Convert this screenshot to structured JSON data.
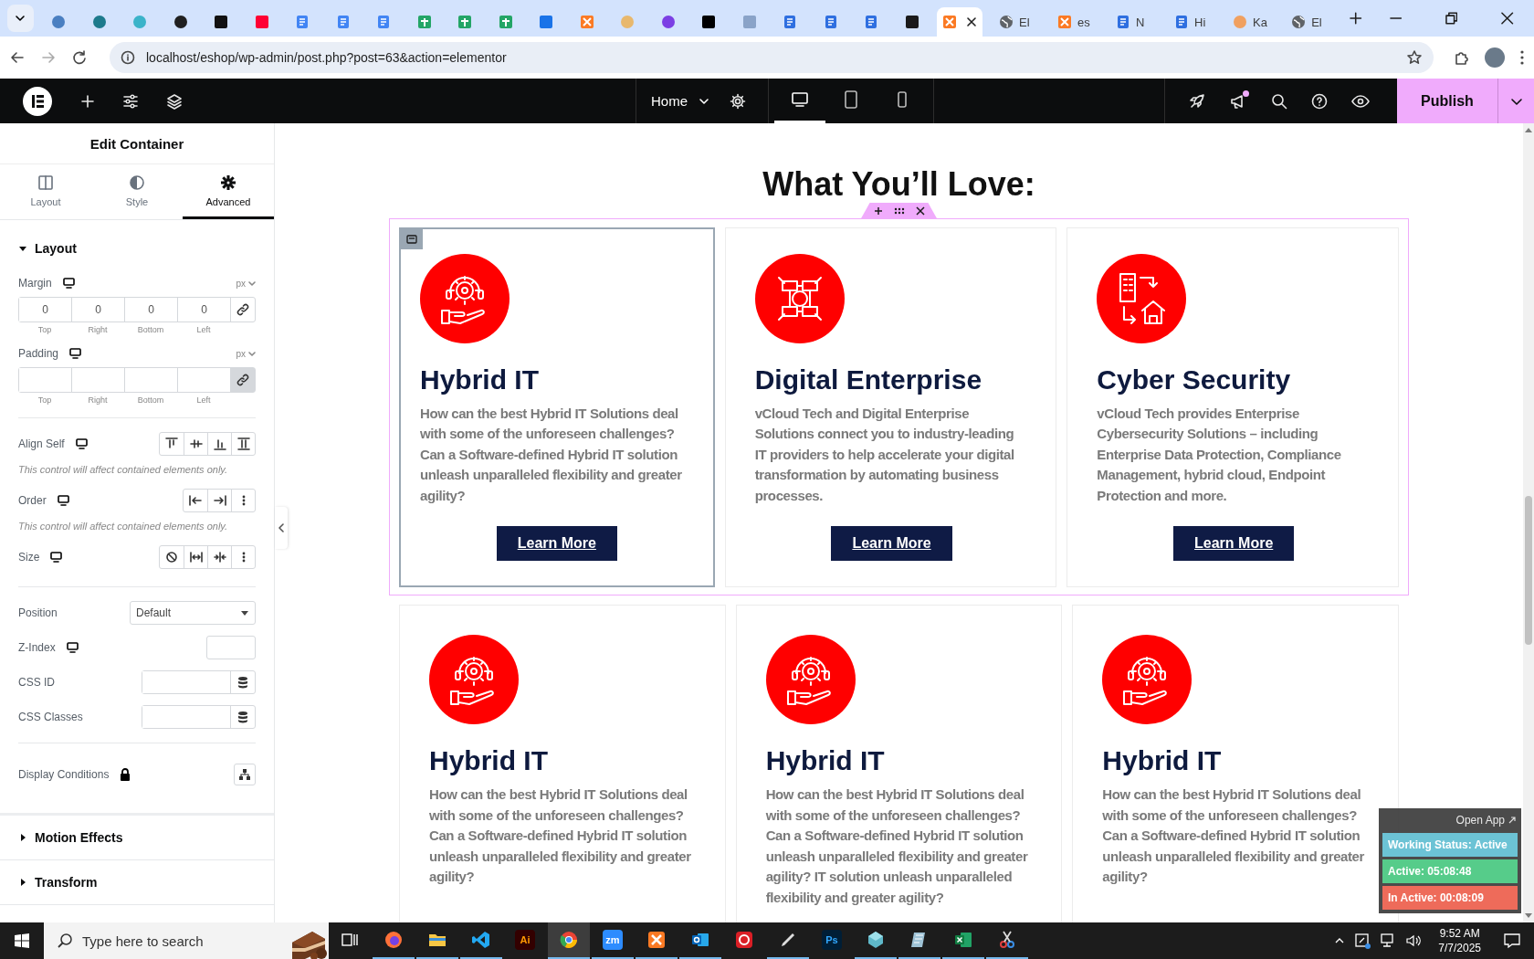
{
  "browser": {
    "tabs": [
      {
        "kind": "circle",
        "color": "#4a7fc1",
        "selected": false
      },
      {
        "kind": "circle",
        "color": "#1d7a8c",
        "selected": false
      },
      {
        "kind": "circle",
        "color": "#3bb3c9",
        "selected": false
      },
      {
        "kind": "circle",
        "color": "#202020",
        "selected": false
      },
      {
        "kind": "square",
        "color": "#111111",
        "selected": false
      },
      {
        "kind": "square",
        "color": "#ff0033",
        "selected": false
      },
      {
        "kind": "doc",
        "color": "#4285f4",
        "selected": false
      },
      {
        "kind": "doc",
        "color": "#4285f4",
        "selected": false
      },
      {
        "kind": "doc",
        "color": "#4285f4",
        "selected": false
      },
      {
        "kind": "sheet",
        "color": "#23a566",
        "selected": false
      },
      {
        "kind": "sheet",
        "color": "#23a566",
        "selected": false
      },
      {
        "kind": "sheet",
        "color": "#23a566",
        "selected": false
      },
      {
        "kind": "square",
        "color": "#1a73e8",
        "selected": false
      },
      {
        "kind": "xampp",
        "color": "#fb7a24",
        "selected": false
      },
      {
        "kind": "circle",
        "color": "#e8b86d",
        "selected": false
      },
      {
        "kind": "circle",
        "color": "#7b3fe4",
        "selected": false
      },
      {
        "kind": "square",
        "color": "#000000",
        "selected": false
      },
      {
        "kind": "square",
        "color": "#8aa3c8",
        "selected": false
      },
      {
        "kind": "doc",
        "color": "#2f6fe0",
        "selected": false
      },
      {
        "kind": "doc",
        "color": "#2f6fe0",
        "selected": false
      },
      {
        "kind": "doc",
        "color": "#2f6fe0",
        "selected": false
      },
      {
        "kind": "square",
        "color": "#1a1a1a",
        "selected": false
      },
      {
        "kind": "xampp",
        "color": "#fb7a24",
        "selected": true
      },
      {
        "kind": "globe",
        "color": "#5f6368",
        "title": "El",
        "selected": false
      },
      {
        "kind": "xampp",
        "color": "#fb7a24",
        "title": "es",
        "selected": false
      },
      {
        "kind": "doc",
        "color": "#2f6fe0",
        "title": "N",
        "selected": false
      },
      {
        "kind": "doc",
        "color": "#2f6fe0",
        "title": "Hi",
        "selected": false
      },
      {
        "kind": "circle",
        "color": "#f0a060",
        "title": "Ka",
        "selected": false
      },
      {
        "kind": "globe",
        "color": "#5f6368",
        "title": "El",
        "selected": false
      }
    ],
    "url": "localhost/eshop/wp-admin/post.php?post=63&action=elementor"
  },
  "editor_bar": {
    "page": "Home",
    "devices": [
      {
        "kind": "desktop",
        "selected": true
      },
      {
        "kind": "tablet",
        "selected": false
      },
      {
        "kind": "mobile",
        "selected": false
      }
    ],
    "notification_dot": true,
    "publish": "Publish"
  },
  "panel": {
    "title": "Edit Container",
    "tabs": [
      {
        "label": "Layout",
        "kind": "layout",
        "selected": false
      },
      {
        "label": "Style",
        "kind": "style",
        "selected": false
      },
      {
        "label": "Advanced",
        "kind": "advanced",
        "selected": true
      }
    ],
    "sections": [
      {
        "title": "Layout",
        "expanded": true,
        "controls": [
          {
            "kind": "dimensions",
            "label": "Margin",
            "responsive": true,
            "unit": "px",
            "values": [
              "0",
              "0",
              "0",
              "0"
            ],
            "captions": [
              "Top",
              "Right",
              "Bottom",
              "Left"
            ],
            "linked": false
          },
          {
            "kind": "dimensions",
            "label": "Padding",
            "responsive": true,
            "unit": "px",
            "captions": [
              "Top",
              "Right",
              "Bottom",
              "Left"
            ],
            "linked": true
          },
          {
            "kind": "divider"
          },
          {
            "kind": "align-self",
            "label": "Align Self",
            "responsive": true,
            "note": "This control will affect contained elements only."
          },
          {
            "kind": "order",
            "label": "Order",
            "responsive": true,
            "note": "This control will affect contained elements only."
          },
          {
            "kind": "size",
            "label": "Size",
            "responsive": true
          },
          {
            "kind": "divider"
          },
          {
            "kind": "select",
            "label": "Position",
            "value": "Default"
          },
          {
            "kind": "number",
            "label": "Z-Index",
            "responsive": true
          },
          {
            "kind": "dynamic-text",
            "label": "CSS ID"
          },
          {
            "kind": "dynamic-text",
            "label": "CSS Classes"
          },
          {
            "kind": "divider"
          },
          {
            "kind": "conditions",
            "label": "Display Conditions",
            "locked": true
          }
        ]
      },
      {
        "title": "Motion Effects",
        "expanded": false
      },
      {
        "title": "Transform",
        "expanded": false
      }
    ]
  },
  "canvas": {
    "heading": "What You’ll Love:",
    "rows": [
      {
        "selected": true,
        "cards": [
          {
            "kind": "support",
            "selected": true,
            "title": "Hybrid IT",
            "text": "How can the best Hybrid IT Solutions deal with some of the unforeseen challenges? Can a Software-defined Hybrid IT solution unleash unparalleled flexibility and greater agility?",
            "button": "Learn More"
          },
          {
            "kind": "teamwork",
            "selected": false,
            "title": "Digital Enterprise",
            "text": "vCloud Tech and Digital Enterprise Solutions connect you to industry-leading IT providers to help accelerate your digital transformation by automating business processes.",
            "button": "Learn More"
          },
          {
            "kind": "office",
            "selected": false,
            "title": "Cyber Security",
            "text": "vCloud Tech provides Enterprise Cybersecurity Solutions – including Enterprise Data Protection, Compliance Management, hybrid cloud, Endpoint Protection and more.",
            "button": "Learn More"
          }
        ]
      },
      {
        "selected": false,
        "cards": [
          {
            "kind": "support",
            "selected": false,
            "title": "Hybrid IT",
            "text": "How can the best Hybrid IT Solutions deal with some of the unforeseen challenges? Can a Software-defined Hybrid IT solution unleash unparalleled flexibility and greater agility?"
          },
          {
            "kind": "support",
            "selected": false,
            "title": "Hybrid IT",
            "text": "How can the best Hybrid IT Solutions deal with some of the unforeseen challenges? Can a Software-defined Hybrid IT solution unleash unparalleled flexibility and greater agility? IT solution unleash unparalleled flexibility and greater agility?"
          },
          {
            "kind": "support",
            "selected": false,
            "title": "Hybrid IT",
            "text": "How can the best Hybrid IT Solutions deal with some of the unforeseen challenges? Can a Software-defined Hybrid IT solution unleash unparalleled flexibility and greater agility?"
          }
        ]
      }
    ]
  },
  "tracker": {
    "link": "Open App",
    "rows": [
      {
        "text": "Working Status: Active",
        "color": "#6cc3d5"
      },
      {
        "text": "Active: 05:08:48",
        "color": "#56cc8a"
      },
      {
        "text": "In Active: 00:08:09",
        "color": "#ee6b5a"
      }
    ]
  },
  "taskbar": {
    "search_placeholder": "Type here to search",
    "apps": [
      {
        "kind": "task-view",
        "running": false,
        "selected": false
      },
      {
        "kind": "firefox",
        "running": true,
        "selected": false
      },
      {
        "kind": "explorer",
        "running": true,
        "selected": false
      },
      {
        "kind": "vscode",
        "running": true,
        "selected": false
      },
      {
        "kind": "illustrator",
        "label": "Ai",
        "running": false,
        "selected": false
      },
      {
        "kind": "chrome",
        "running": true,
        "selected": true
      },
      {
        "kind": "zoom",
        "label": "zm",
        "running": true,
        "selected": false
      },
      {
        "kind": "xampp",
        "running": true,
        "selected": false
      },
      {
        "kind": "outlook",
        "running": true,
        "selected": false
      },
      {
        "kind": "creative-cloud",
        "running": false,
        "selected": false
      },
      {
        "kind": "pen",
        "running": true,
        "selected": false
      },
      {
        "kind": "photoshop",
        "label": "Ps",
        "running": false,
        "selected": false
      },
      {
        "kind": "cube",
        "running": true,
        "selected": false
      },
      {
        "kind": "notes",
        "running": true,
        "selected": false
      },
      {
        "kind": "excel",
        "running": true,
        "selected": false
      },
      {
        "kind": "snip",
        "running": true,
        "selected": false
      }
    ],
    "time": "9:52 AM",
    "date": "7/7/2025"
  }
}
